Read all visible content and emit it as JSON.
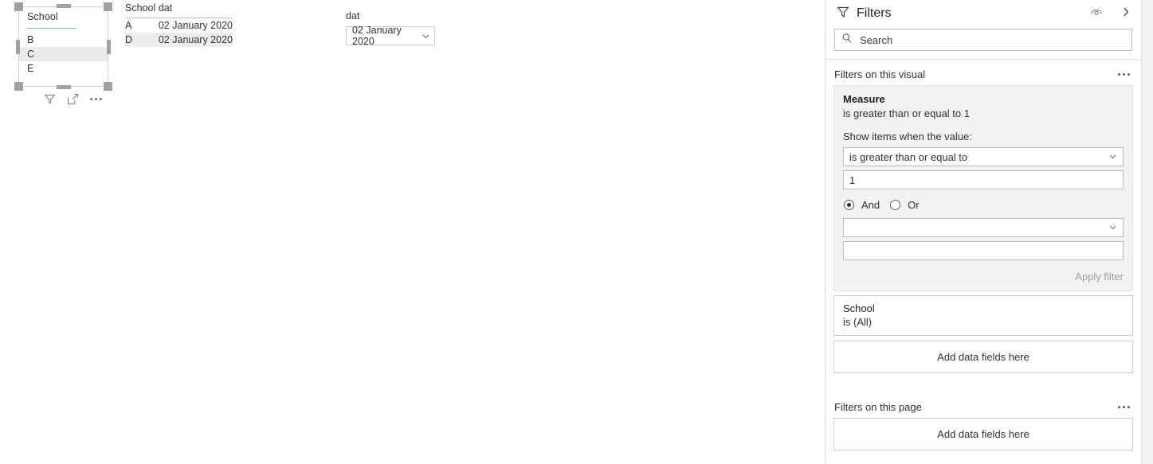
{
  "canvas": {
    "slicer": {
      "title": "School",
      "items": [
        {
          "label": "B",
          "selected": false
        },
        {
          "label": "C",
          "selected": true
        },
        {
          "label": "E",
          "selected": false
        }
      ],
      "actions": [
        "filter-icon",
        "focus-mode-icon",
        "more-options-icon"
      ]
    },
    "table": {
      "columns": [
        "School",
        "dat"
      ],
      "rows": [
        [
          "A",
          "02 January 2020"
        ],
        [
          "D",
          "02 January 2020"
        ]
      ]
    },
    "date_slicer": {
      "label": "dat",
      "value": "02 January 2020",
      "chevron": "chevron-down-icon"
    }
  },
  "filters_pane": {
    "title": "Filters",
    "funnel_icon": "funnel-icon",
    "eye_icon": "eye-icon",
    "collapse_icon": "chevron-right-icon",
    "search": {
      "placeholder": "Search",
      "icon": "search-icon",
      "value": ""
    },
    "visual_section": {
      "heading": "Filters on this visual",
      "more_icon": "more-options-icon",
      "measure_card": {
        "field": "Measure",
        "summary": "is greater than or equal to 1",
        "prompt": "Show items when the value:",
        "condition1": "is greater than or equal to",
        "value1": "1",
        "operator_and": "And",
        "operator_or": "Or",
        "operator_selected": "And",
        "condition2": "",
        "value2": "",
        "apply_label": "Apply filter"
      },
      "school_card": {
        "field": "School",
        "summary": "is (All)"
      },
      "dropzone": "Add data fields here"
    },
    "page_section": {
      "heading": "Filters on this page",
      "more_icon": "more-options-icon",
      "dropzone": "Add data fields here"
    }
  },
  "colors": {
    "accent_underline": "#7ab2e0",
    "card_bg": "#f3f2f1",
    "selected_row": "#ebebeb",
    "table_alt_row": "#ececec"
  }
}
